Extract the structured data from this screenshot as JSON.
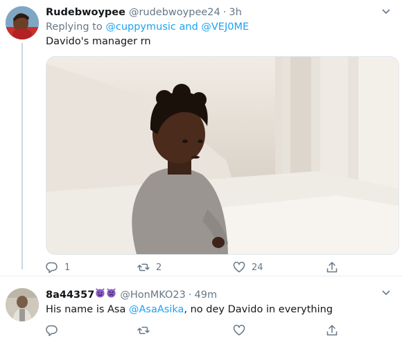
{
  "tweets": [
    {
      "display_name": "Rudebwoypee",
      "handle": "@rudebwoypee24",
      "separator": "·",
      "time": "3h",
      "replying_prefix": "Replying to",
      "replying_user_1": "@cuppymusic",
      "replying_and": "and",
      "replying_user_2": "@VEJ0ME",
      "text": "Davido's manager rn",
      "media_alt": "Photo of a toddler sitting on a white couch",
      "replies": "1",
      "retweets": "2",
      "likes": "24"
    },
    {
      "display_name": "8a44357",
      "name_emojis": [
        "smiling-devil-emoji",
        "angry-devil-emoji"
      ],
      "handle": "@HonMKO23",
      "separator": "·",
      "time": "49m",
      "text_prefix": "His name is Asa",
      "mention": "@AsaAsika",
      "text_suffix": ", no dey Davido in everything",
      "replies": "",
      "retweets": "",
      "likes": ""
    }
  ],
  "colors": {
    "link": "#1da1f2",
    "secondary_text": "#657786",
    "primary_text": "#14171a",
    "thread_line": "#ccd6dd",
    "emoji_purple": "#8b5cc8"
  }
}
